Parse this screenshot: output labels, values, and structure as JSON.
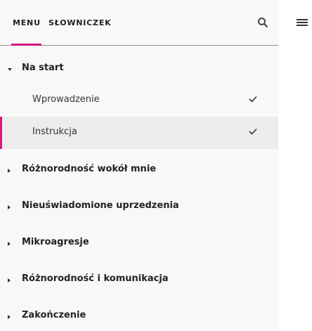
{
  "header": {
    "tabs": [
      {
        "label": "MENU",
        "active": true
      },
      {
        "label": "SŁOWNICZEK",
        "active": false
      }
    ],
    "search_icon": "search-icon"
  },
  "menu": {
    "sections": [
      {
        "label": "Na start",
        "expanded": true,
        "children": [
          {
            "label": "Wprowadzenie",
            "completed": true,
            "active": false
          },
          {
            "label": "Instrukcja",
            "completed": true,
            "active": true
          }
        ]
      },
      {
        "label": "Różnorodność wokół mnie",
        "expanded": false
      },
      {
        "label": "Nieuświadomione uprzedzenia",
        "expanded": false
      },
      {
        "label": "Mikroagresje",
        "expanded": false
      },
      {
        "label": "Różnorodność i komunikacja",
        "expanded": false
      },
      {
        "label": "Zakończenie",
        "expanded": false
      }
    ]
  },
  "colors": {
    "accent": "#d6177e",
    "sidebar_bg": "#f9f8f8",
    "active_item_bg": "#ececec"
  },
  "right_panel": {
    "menu_icon": "hamburger-icon"
  }
}
